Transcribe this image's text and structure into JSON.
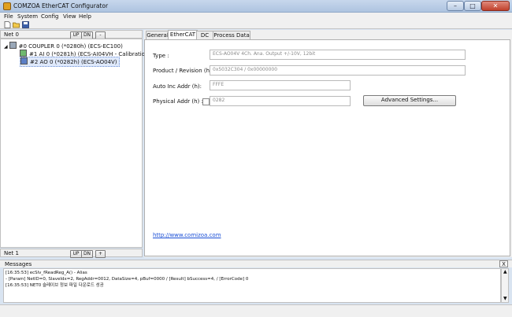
{
  "window": {
    "title": "COMZOA EtherCAT Configurator",
    "min": "–",
    "max": "□",
    "close": "✕"
  },
  "menu": [
    "File",
    "System",
    "Config",
    "View",
    "Help"
  ],
  "toolbar_icons": [
    "new-file-icon",
    "open-folder-icon",
    "save-icon"
  ],
  "net0": {
    "label": "Net 0",
    "up": "UP",
    "dn": "DN",
    "minus": "-",
    "tree": [
      {
        "text": "#0 COUPLER 0 (*0280h) (ECS-EC100)",
        "icon": "coupler-icon"
      },
      {
        "text": "#1 AI 0 (*0281h) (ECS-AI04VH - Calibration)",
        "icon": "module-icon"
      },
      {
        "text": "#2 AO 0 (*0282h) (ECS-AO04V)",
        "icon": "module-icon",
        "selected": true
      }
    ]
  },
  "net1": {
    "label": "Net 1",
    "up": "UP",
    "dn": "DN",
    "plus": "+"
  },
  "tabs": [
    "General",
    "EtherCAT",
    "DC",
    "Process Data"
  ],
  "active_tab": "EtherCAT",
  "ethercat": {
    "type_label": "Type :",
    "type_value": "ECS-AO04V 4Ch. Ana. Output +/-10V, 12bit",
    "product_label": "Product / Revision (h) :",
    "product_value": "0x5032C304 / 0x00000000",
    "autoinc_label": "Auto Inc Addr (h):",
    "autoinc_value": "FFFE",
    "physical_label": "Physical Addr (h)  :",
    "physical_value": "0282",
    "advanced_button": "Advanced Settings...",
    "link": "http://www.comizoa.com"
  },
  "messages": {
    "title": "Messages",
    "close": "X",
    "lines": [
      "[16:35:53] ecSlv_fReadReg_A() - Alias",
      "    - [Param] NetID=0, SlaveIdx=2, RegAddr=0012, DataSize=4, pBuf=0000 / [Result] bSuccess=4, / [ErrorCode] 0",
      "[16:35:53] NET0 슬레이브 정보 파일 다운로드 성공"
    ]
  },
  "colors": {
    "accent": "#1a4fd6",
    "selection": "#dfe9fb"
  }
}
